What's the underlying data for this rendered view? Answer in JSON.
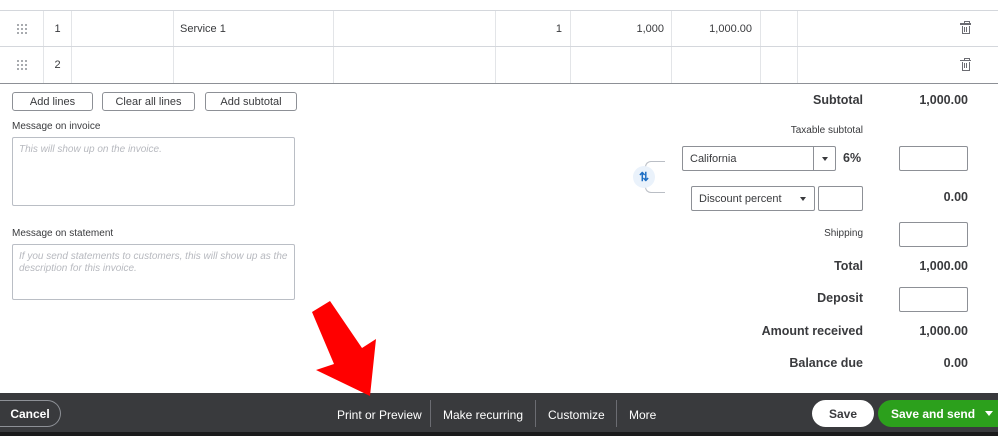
{
  "line_items": {
    "rows": [
      {
        "num": "1",
        "product": "Service 1",
        "qty": "1",
        "rate": "1,000",
        "amount": "1,000.00"
      },
      {
        "num": "2",
        "product": "",
        "qty": "",
        "rate": "",
        "amount": ""
      }
    ]
  },
  "line_buttons": {
    "add_lines": "Add lines",
    "clear_all_lines": "Clear all lines",
    "add_subtotal": "Add subtotal"
  },
  "messages": {
    "invoice_label": "Message on invoice",
    "invoice_placeholder": "This will show up on the invoice.",
    "statement_label": "Message on statement",
    "statement_placeholder": "If you send statements to customers, this will show up as the description for this invoice."
  },
  "totals": {
    "subtotal_label": "Subtotal",
    "subtotal_value": "1,000.00",
    "taxable_subtotal_label": "Taxable subtotal",
    "tax_region": "California",
    "tax_rate": "6%",
    "discount_type": "Discount percent",
    "discount_value": "0.00",
    "shipping_label": "Shipping",
    "total_label": "Total",
    "total_value": "1,000.00",
    "deposit_label": "Deposit",
    "amount_received_label": "Amount received",
    "amount_received_value": "1,000.00",
    "balance_due_label": "Balance due",
    "balance_due_value": "0.00"
  },
  "footer": {
    "cancel": "Cancel",
    "print_or_preview": "Print or Preview",
    "make_recurring": "Make recurring",
    "customize": "Customize",
    "more": "More",
    "save": "Save",
    "save_and_send": "Save and send"
  },
  "icons": {
    "drag_handle": "drag-handle-icon",
    "delete": "trash-icon",
    "toggle": "swap-arrows-icon",
    "annotation": "red-arrow-icon"
  },
  "colors": {
    "primary_green": "#2ca01c",
    "footer_bg": "#393a3d",
    "annotation_red": "#ff0000"
  }
}
